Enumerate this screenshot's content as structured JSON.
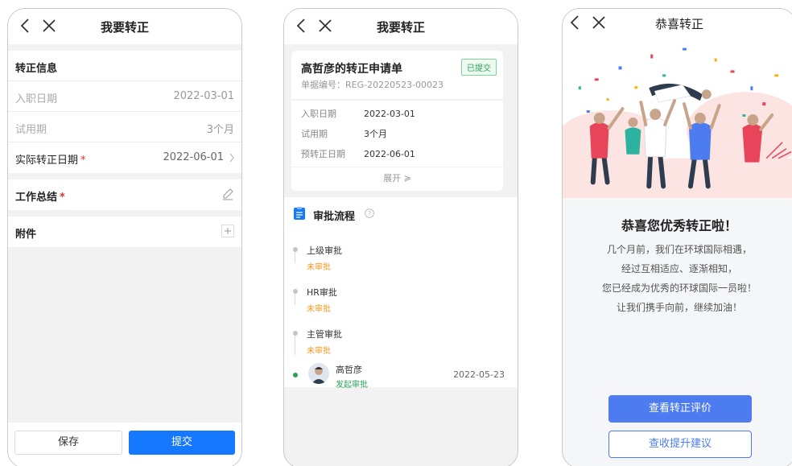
{
  "screen1": {
    "title": "我要转正",
    "section_title": "转正信息",
    "rows": [
      {
        "label": "入职日期",
        "value": "2022-03-01"
      },
      {
        "label": "试用期",
        "value": "3个月"
      },
      {
        "label": "实际转正日期",
        "value": "2022-06-01"
      }
    ],
    "required_mark": "*",
    "summary_label": "工作总结",
    "attachment_label": "附件",
    "save_label": "保存",
    "submit_label": "提交"
  },
  "screen2": {
    "title": "我要转正",
    "apply_title": "高哲彦的转正申请单",
    "apply_no": "单据编号：REG-20220523-00023",
    "status_badge": "已提交",
    "details": [
      {
        "label": "入职日期",
        "value": "2022-03-01"
      },
      {
        "label": "试用期",
        "value": "3个月"
      },
      {
        "label": "预转正日期",
        "value": "2022-06-01"
      }
    ],
    "expand_label": "展开 ≽",
    "flow_title": "审批流程",
    "flow": [
      {
        "name": "上级审批",
        "status": "未审批"
      },
      {
        "name": "HR审批",
        "status": "未审批"
      },
      {
        "name": "主管审批",
        "status": "未审批"
      }
    ],
    "initiator": {
      "name": "高哲彦",
      "status": "发起审批",
      "date": "2022-05-23"
    }
  },
  "screen3": {
    "title": "恭喜转正",
    "heading": "恭喜您优秀转正啦！",
    "lines": [
      "几个月前，我们在环球国际相遇，",
      "经过互相适应、逐渐相知，",
      "您已经成为优秀的环球国际一员啦！",
      "让我们携手向前，继续加油！"
    ],
    "primary_button": "查看转正评价",
    "secondary_button": "查收提升建议"
  },
  "colors": {
    "primary": "#1677ff",
    "accent_blue": "#4d7cf0",
    "success": "#27a354",
    "warning": "#f59a23",
    "required": "#e03131"
  },
  "icons": [
    "back-icon",
    "close-icon",
    "chevron-right-icon",
    "edit-icon",
    "plus-icon",
    "clipboard-icon",
    "help-icon"
  ]
}
